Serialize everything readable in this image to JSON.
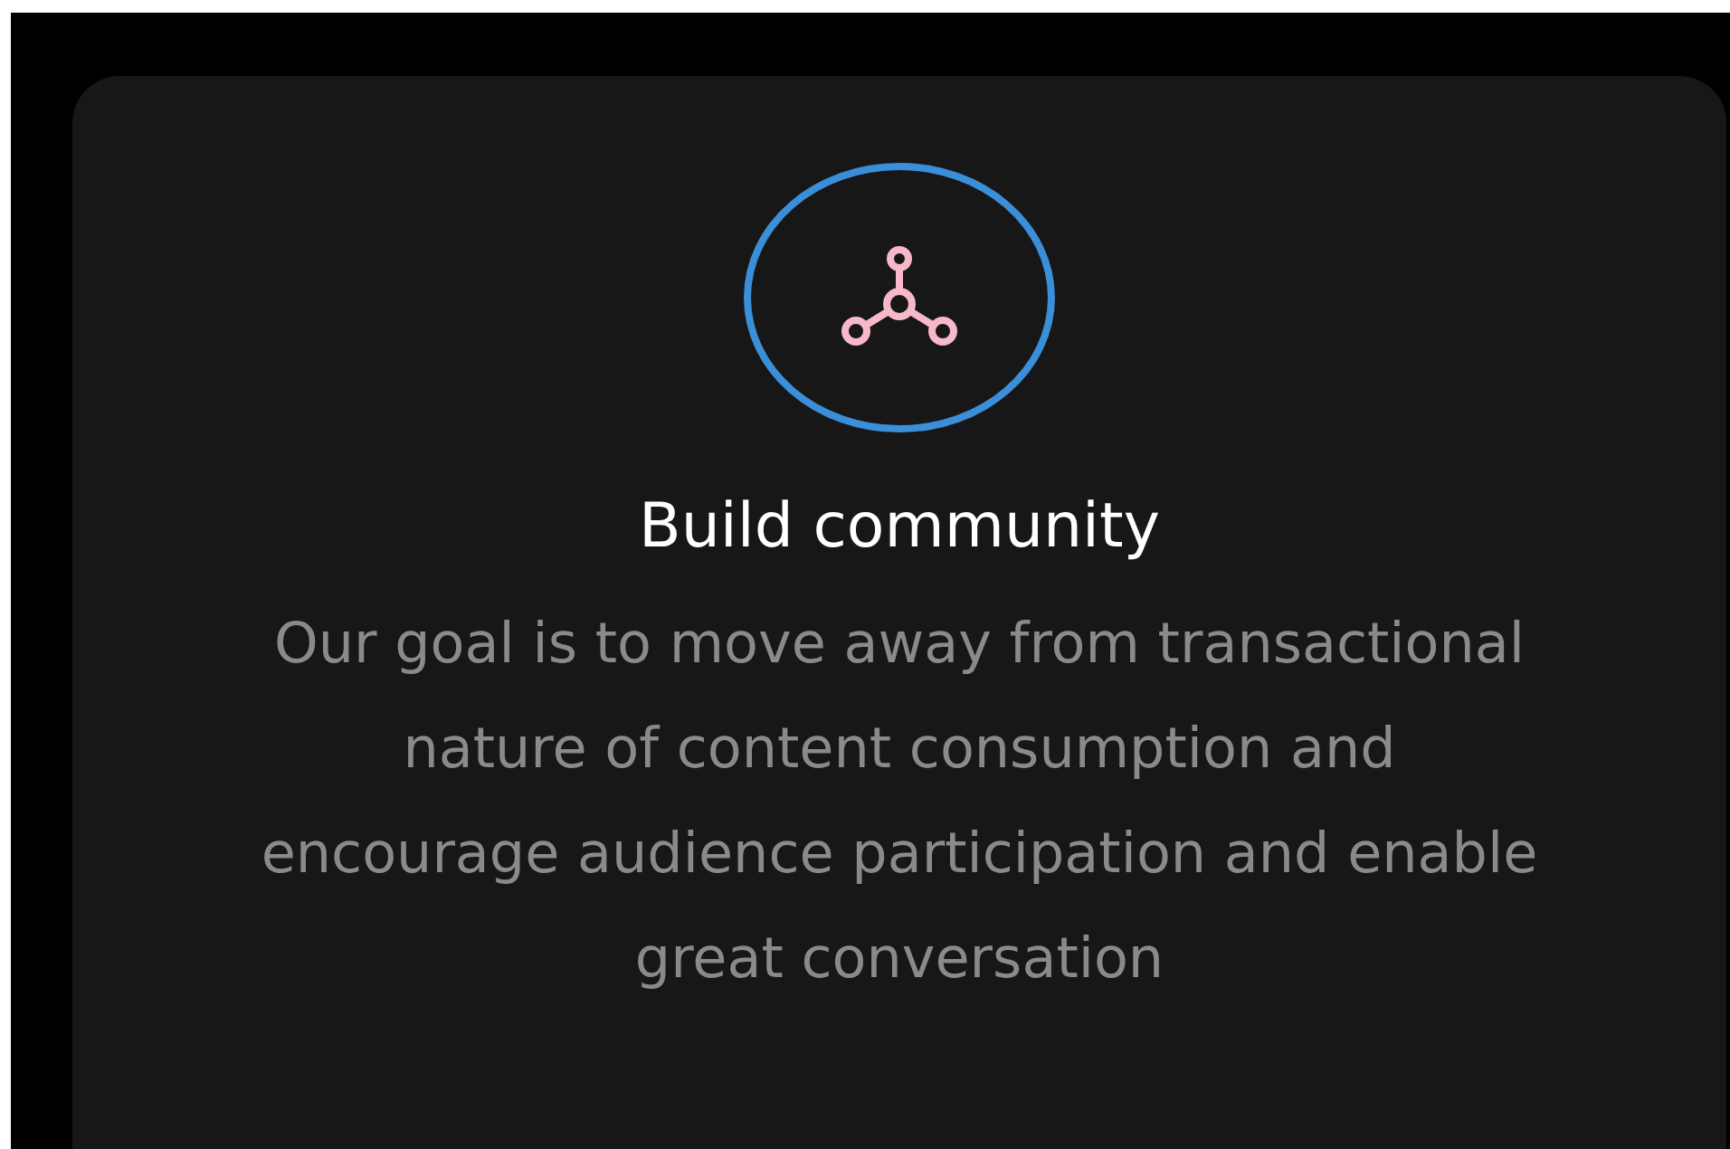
{
  "card": {
    "title": "Build community",
    "description": "Our goal is to move away from transactional nature of content consumption and encourage audience participation and enable great conversation"
  }
}
